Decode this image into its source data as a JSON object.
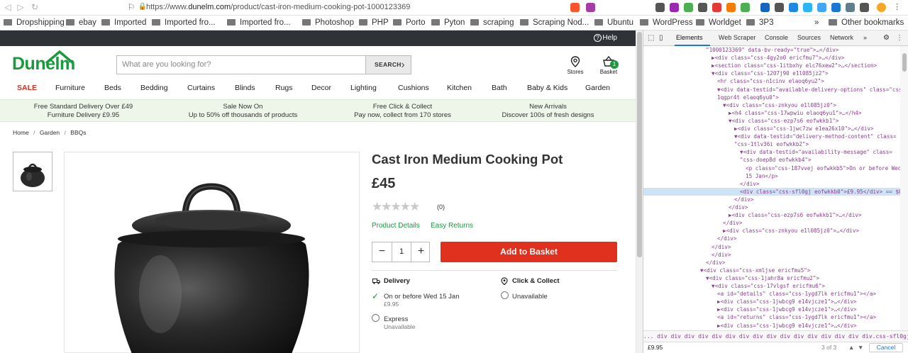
{
  "browser": {
    "url_prefix": "https://www.",
    "url_host": "dunelm.com",
    "url_path": "/product/cast-iron-medium-cooking-pot-1000123369",
    "brave_count": "4",
    "alert_count": "1"
  },
  "bookmarks": {
    "items": [
      "Dropshipping",
      "ebay",
      "Imported",
      "Imported fro...",
      "Imported fro...",
      "Photoshop",
      "PHP",
      "Porto",
      "Pyton",
      "scraping",
      "Scraping Nod...",
      "Ubuntu",
      "WordPress",
      "Worldget",
      "3P3"
    ],
    "more_label": "»",
    "other_label": "Other bookmarks"
  },
  "site": {
    "help_label": "Help",
    "logo_text": "Dunelm",
    "search_placeholder": "What are you looking for?",
    "search_button": "SEARCH",
    "stores_label": "Stores",
    "basket_label": "Basket",
    "basket_count": "1",
    "nav": [
      "SALE",
      "Furniture",
      "Beds",
      "Bedding",
      "Curtains",
      "Blinds",
      "Rugs",
      "Decor",
      "Lighting",
      "Cushions",
      "Kitchen",
      "Bath",
      "Baby & Kids",
      "Garden"
    ],
    "promos": [
      {
        "title": "Free Standard Delivery Over £49",
        "sub": "Furniture Delivery £9.95"
      },
      {
        "title": "Sale Now On",
        "sub": "Up to 50% off thousands of products"
      },
      {
        "title": "Free Click & Collect",
        "sub": "Pay now, collect from 170 stores"
      },
      {
        "title": "New Arrivals",
        "sub": "Discover 100s of fresh designs"
      }
    ],
    "breadcrumb": [
      "Home",
      "Garden",
      "BBQs"
    ],
    "breadcrumb_sep": "/"
  },
  "product": {
    "title": "Cast Iron Medium Cooking Pot",
    "price": "£45",
    "rating_stars": 0,
    "rating_max": 5,
    "review_count": "(0)",
    "link_details": "Product Details",
    "link_returns": "Easy Returns",
    "quantity": "1",
    "add_to_basket": "Add to Basket",
    "delivery": {
      "heading": "Delivery",
      "date": "On or before Wed 15 Jan",
      "cost": "£9.95",
      "express_label": "Express",
      "express_status": "Unavailable"
    },
    "collect": {
      "heading": "Click & Collect",
      "status": "Unavailable"
    }
  },
  "devtools": {
    "tabs": [
      "Elements",
      "Web Scraper",
      "Console",
      "Sources",
      "Network"
    ],
    "more_tabs": "»",
    "lines": [
      "\"1000123369\" data-bv-ready=\"true\">…</div>",
      "▶<div class=\"css-4gy2o0 ericfmu7\">…</div>",
      "▶<section class=\"css-1itbxhy elc76xew2\">…</section>",
      "▼<div class=\"css-1207j90 e1l085jz2\">",
      "<hr class=\"css-n1cinv elaoq6yu2\">",
      "▼<div data-testid=\"available-delivery-options\" class=\"css-",
      "1qgpr4t elaoq6yu0\">",
      "▼<div class=\"css-znkyou e1l085jz0\">",
      "▶<h4 class=\"css-17wpwiu elaoq6yu1\">…</h4>",
      "▼<div class=\"css-ezp7s6 eofwkkb1\">",
      "▶<div class=\"css-1jwc7zw e1ea26x10\">…</div>",
      "▼<div data-testid=\"delivery-method-content\" class=",
      "\"css-1tlv36i eofwkkb2\">",
      "▼<div data-testid=\"availability-message\" class=",
      "\"css-doep8d eofwkkb4\">",
      "<p class=\"css-187vvej eofwkkb5\">On or before Wed",
      "15 Jan</p>",
      "</div>",
      "<div class=\"css-sfl0gj eofwkkb0\">£9.95</div> == $0",
      "</div>",
      "</div>",
      "▶<div class=\"css-ezp7s6 eofwkkb1\">…</div>",
      "</div>",
      "▶<div class=\"css-znkyou e1l085jz0\">…</div>",
      "</div>",
      "</div>",
      "</div>",
      "</div>",
      "▼<div class=\"css-xmljse ericfmu5\">",
      "▼<div class=\"css-1jahr8a ericfmu2\">",
      "▼<div class=\"css-17vlgsf ericfmu6\">",
      "<a id=\"details\" class=\"css-1ygd7lk ericfmu1\"></a>",
      "▶<div class=\"css-1jwbcg9 e14vjcze1\">…</div>",
      "▶<div class=\"css-1jwbcg9 e14vjcze1\">…</div>",
      "<a id=\"returns\" class=\"css-1ygd7lk ericfmu1\"></a>",
      "▶<div class=\"css-1jwbcg9 e14vjcze1\">…</div>"
    ],
    "indents": [
      0,
      1,
      1,
      1,
      2,
      2,
      2,
      3,
      4,
      4,
      5,
      5,
      5,
      6,
      6,
      7,
      7,
      6,
      6,
      5,
      4,
      4,
      3,
      3,
      2,
      1,
      1,
      0,
      -1,
      0,
      1,
      2,
      2,
      2,
      2,
      2
    ],
    "selected_index": 18,
    "crumbs": "...  div  div  div  div  div  div  div  div  div  div  div  div  div  div  div  div.css-sfl0gj.eofwkkb0",
    "find_value": "£9.95",
    "find_count": "3 of 3",
    "cancel_label": "Cancel"
  }
}
